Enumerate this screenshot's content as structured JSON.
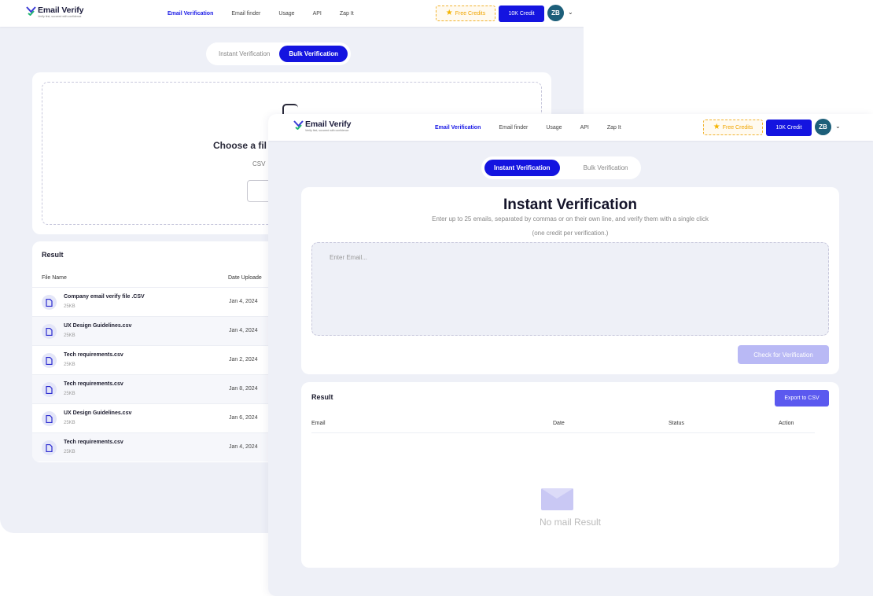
{
  "colors": {
    "accent": "#1414e0",
    "page_bg": "#eef0f7",
    "credits": "#f0a500",
    "export": "#5b59ef"
  },
  "logo": {
    "name": "Email Verify",
    "tagline": "Verify first, succeed with confidence"
  },
  "nav": {
    "items": [
      "Email Verification",
      "Email finder",
      "Usage",
      "API",
      "Zap It"
    ],
    "free_credits": "Free Credits",
    "credit": "10K Credit",
    "avatar": "ZB"
  },
  "tabs": {
    "instant": "Instant Verification",
    "bulk": "Bulk Verification"
  },
  "bulk": {
    "upload_title": "Choose a fil",
    "upload_sub": "CSV",
    "result_title": "Result",
    "columns": [
      "File Name",
      "Date Uploade"
    ],
    "files": [
      {
        "name": "Company email verify file .CSV",
        "size": "25KB",
        "date": "Jan 4, 2024"
      },
      {
        "name": "UX Design Guidelines.csv",
        "size": "25KB",
        "date": "Jan 4, 2024"
      },
      {
        "name": "Tech requirements.csv",
        "size": "25KB",
        "date": "Jan 2, 2024"
      },
      {
        "name": "Tech requirements.csv",
        "size": "25KB",
        "date": "Jan 8, 2024"
      },
      {
        "name": "UX Design Guidelines.csv",
        "size": "25KB",
        "date": "Jan 6, 2024"
      },
      {
        "name": "Tech requirements.csv",
        "size": "25KB",
        "date": "Jan 4, 2024"
      }
    ]
  },
  "instant": {
    "title": "Instant Verification",
    "subtitle": "Enter up to 25 emails, separated by commas or on their own line, and verify them with a single click",
    "note": "(one credit per verification.)",
    "placeholder": "Enter Email...",
    "check_button": "Check for Verification",
    "result_title": "Result",
    "export_button": "Export to CSV",
    "columns": [
      "Email",
      "Date",
      "Status",
      "Action"
    ],
    "empty": "No mail Result"
  }
}
